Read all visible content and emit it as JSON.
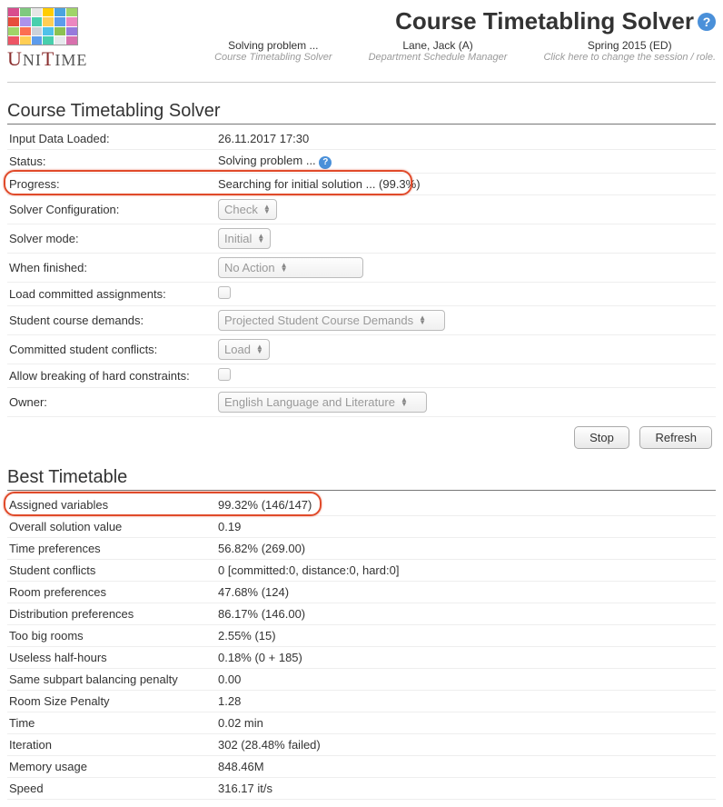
{
  "page_title": "Course Timetabling Solver",
  "context": {
    "left": {
      "main": "Solving problem ...",
      "sub": "Course Timetabling Solver"
    },
    "middle": {
      "main": "Lane, Jack (A)",
      "sub": "Department Schedule Manager"
    },
    "right": {
      "main": "Spring 2015 (ED)",
      "sub": "Click here to change the session / role."
    }
  },
  "solver": {
    "input_data_loaded": {
      "label": "Input Data Loaded:",
      "value": "26.11.2017 17:30"
    },
    "status": {
      "label": "Status:",
      "value": "Solving problem ..."
    },
    "progress": {
      "label": "Progress:",
      "value": "Searching for initial solution ... (99.3%)"
    },
    "solver_configuration": {
      "label": "Solver Configuration:",
      "value": "Check"
    },
    "solver_mode": {
      "label": "Solver mode:",
      "value": "Initial"
    },
    "when_finished": {
      "label": "When finished:",
      "value": "No Action"
    },
    "load_committed": {
      "label": "Load committed assignments:"
    },
    "student_course_demands": {
      "label": "Student course demands:",
      "value": "Projected Student Course Demands"
    },
    "committed_conflicts": {
      "label": "Committed student conflicts:",
      "value": "Load"
    },
    "allow_breaking": {
      "label": "Allow breaking of hard constraints:"
    },
    "owner": {
      "label": "Owner:",
      "value": "English Language and Literature"
    }
  },
  "buttons": {
    "stop": "Stop",
    "refresh": "Refresh"
  },
  "best_title": "Best Timetable",
  "best": {
    "assigned_variables": {
      "label": "Assigned variables",
      "value": "99.32% (146/147)"
    },
    "overall_value": {
      "label": "Overall solution value",
      "value": "0.19"
    },
    "time_prefs": {
      "label": "Time preferences",
      "value": "56.82% (269.00)"
    },
    "student_conflicts": {
      "label": "Student conflicts",
      "value": "0 [committed:0, distance:0, hard:0]"
    },
    "room_prefs": {
      "label": "Room preferences",
      "value": "47.68% (124)"
    },
    "dist_prefs": {
      "label": "Distribution preferences",
      "value": "86.17% (146.00)"
    },
    "too_big": {
      "label": "Too big rooms",
      "value": "2.55% (15)"
    },
    "useless": {
      "label": "Useless half-hours",
      "value": "0.18% (0 + 185)"
    },
    "subpart_penalty": {
      "label": "Same subpart balancing penalty",
      "value": "0.00"
    },
    "room_size_penalty": {
      "label": "Room Size Penalty",
      "value": "1.28"
    },
    "time": {
      "label": "Time",
      "value": "0.02 min"
    },
    "iteration": {
      "label": "Iteration",
      "value": "302 (28.48% failed)"
    },
    "memory": {
      "label": "Memory usage",
      "value": "848.46M"
    },
    "speed": {
      "label": "Speed",
      "value": "316.17 it/s"
    }
  },
  "logo_colors": [
    "#d94c8e",
    "#7fc97f",
    "#e6e6e6",
    "#ffcc00",
    "#4aa3df",
    "#a0d468",
    "#e74c3c",
    "#ac92ec",
    "#48cfad",
    "#ffce54",
    "#5d9cec",
    "#ec87c0",
    "#a0d468",
    "#fc6e51",
    "#ccd1d9",
    "#4fc1e9",
    "#8cc152",
    "#967adc",
    "#ed5565",
    "#ffce54",
    "#5d9cec",
    "#48cfad",
    "#e6e9ed",
    "#d770ad"
  ]
}
